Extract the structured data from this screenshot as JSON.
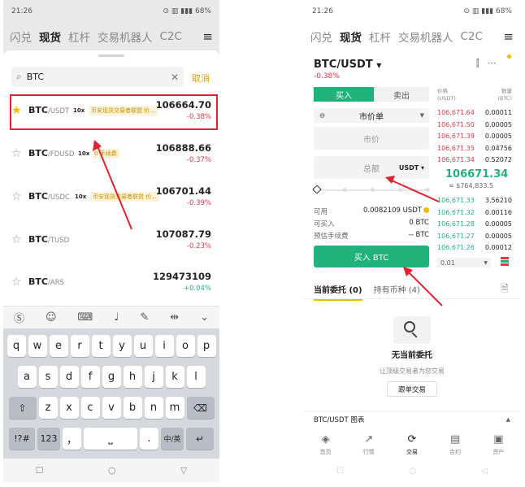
{
  "status": {
    "time": "21:26",
    "battery": "68%"
  },
  "nav": {
    "tabs": [
      "闪兑",
      "现货",
      "杠杆",
      "交易机器人",
      "C2C"
    ],
    "menu": "≡"
  },
  "search": {
    "query": "BTC",
    "cancel": "取消"
  },
  "results": [
    {
      "base": "BTC",
      "quote": "/USDT",
      "lev": "10x",
      "tag": "币安现货交易者联盟 价...",
      "price": "106664.70",
      "change": "-0.38%",
      "fav": true
    },
    {
      "base": "BTC",
      "quote": "/FDUSD",
      "lev": "10x",
      "tag": "0 手续费",
      "price": "106888.66",
      "change": "-0.37%",
      "fav": false
    },
    {
      "base": "BTC",
      "quote": "/USDC",
      "lev": "10x",
      "tag": "币安现货交易者联盟 价...",
      "price": "106701.44",
      "change": "-0.39%",
      "fav": false
    },
    {
      "base": "BTC",
      "quote": "/TUSD",
      "lev": "",
      "tag": "",
      "price": "107087.79",
      "change": "-0.23%",
      "fav": false
    },
    {
      "base": "BTC",
      "quote": "/ARS",
      "lev": "",
      "tag": "",
      "price": "129473109",
      "change": "+0.04%",
      "fav": false
    }
  ],
  "keyboard": {
    "row1": [
      "q",
      "w",
      "e",
      "r",
      "t",
      "y",
      "u",
      "i",
      "o",
      "p"
    ],
    "row2": [
      "a",
      "s",
      "d",
      "f",
      "g",
      "h",
      "j",
      "k",
      "l"
    ],
    "row3": [
      "z",
      "x",
      "c",
      "v",
      "b",
      "n",
      "m"
    ],
    "bottom": {
      "sym": "!?#",
      "num": "123",
      "comma": "，",
      "dot": ".",
      "lang": "中/英"
    }
  },
  "trade": {
    "pair": "BTC/USDT",
    "change": "-0.38%",
    "buy_tab": "买入",
    "sell_tab": "卖出",
    "order_type": "市价单",
    "market_field": "市价",
    "amount_field": "总额",
    "amount_unit": "USDT",
    "available_label": "可用",
    "available_value": "0.0082109 USDT",
    "can_buy_label": "可买入",
    "can_buy_value": "0 BTC",
    "fee_label": "预估手续费",
    "fee_value": "-- BTC",
    "buy_button": "买入 BTC",
    "ob_price_head": "价格\n(USDT)",
    "ob_qty_head": "数量\n(BTC)",
    "asks": [
      {
        "p": "106,671.64",
        "q": "0.00011"
      },
      {
        "p": "106,671.50",
        "q": "0.00005"
      },
      {
        "p": "106,671.39",
        "q": "0.00005"
      },
      {
        "p": "106,671.35",
        "q": "0.04756"
      },
      {
        "p": "106,671.34",
        "q": "0.52072"
      }
    ],
    "mid_price": "106671.34",
    "mid_usd": "≈ $764,833.5",
    "bids": [
      {
        "p": "106,671.33",
        "q": "3.56210"
      },
      {
        "p": "106,671.32",
        "q": "0.00116"
      },
      {
        "p": "106,671.28",
        "q": "0.00005"
      },
      {
        "p": "106,671.27",
        "q": "0.00005"
      },
      {
        "p": "106,671.26",
        "q": "0.00012"
      }
    ],
    "precision": "0.01",
    "orders_tab": "当前委托",
    "orders_count": "(0)",
    "holdings_tab": "持有币种",
    "holdings_count": "(4)",
    "empty_title": "无当前委托",
    "empty_sub": "让顶级交易者为您交易",
    "follow_btn": "跟单交易",
    "chart_bar": "BTC/USDT 图表",
    "bottom_tabs": [
      "首页",
      "行情",
      "交易",
      "合约",
      "资产"
    ]
  },
  "colors": {
    "green": "#21b27c",
    "red": "#e0394a",
    "yellow": "#f0b90b",
    "highlight": "#e5222f"
  }
}
